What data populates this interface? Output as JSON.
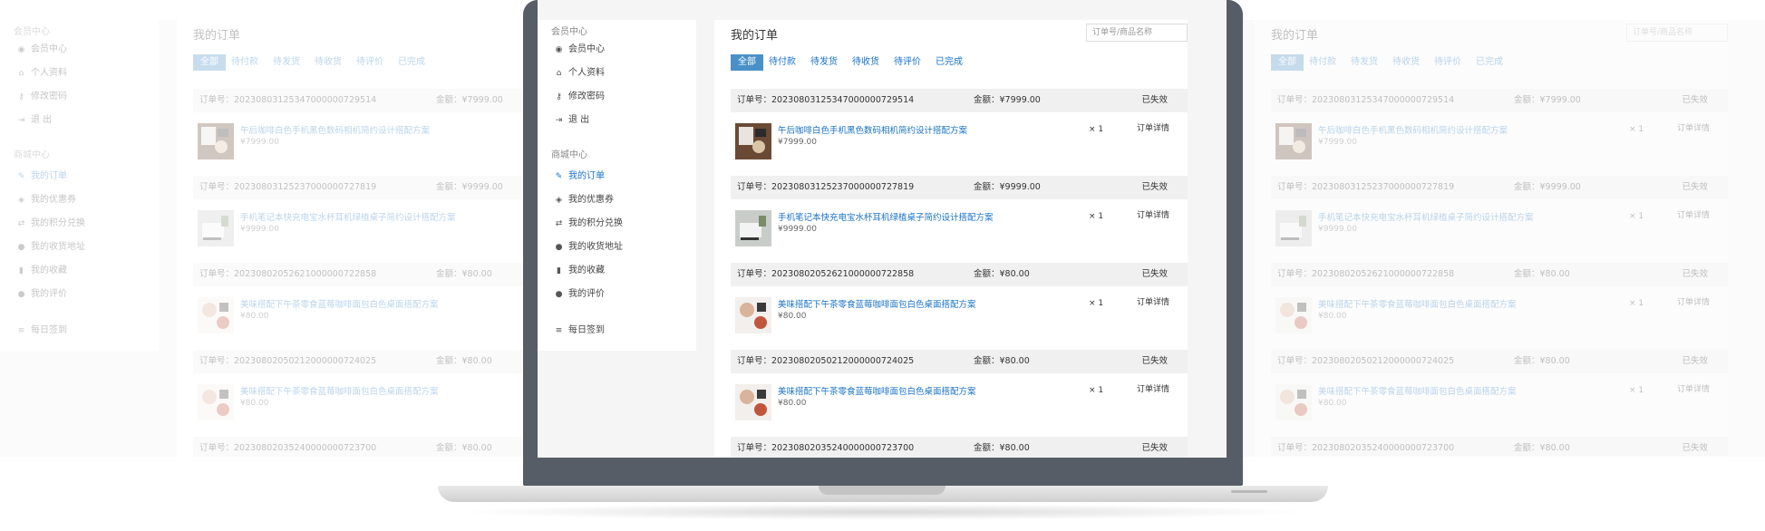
{
  "sidebar": {
    "member_title": "会员中心",
    "member_items": [
      {
        "label": "会员中心",
        "icon": "user-icon"
      },
      {
        "label": "个人资料",
        "icon": "lock-icon"
      },
      {
        "label": "修改密码",
        "icon": "key-icon"
      },
      {
        "label": "退 出",
        "icon": "logout-icon"
      }
    ],
    "mall_title": "商城中心",
    "mall_items": [
      {
        "label": "我的订单",
        "icon": "pencil-icon",
        "active": true
      },
      {
        "label": "我的优惠券",
        "icon": "tag-icon"
      },
      {
        "label": "我的积分兑换",
        "icon": "exchange-icon"
      },
      {
        "label": "我的收货地址",
        "icon": "map-pin-icon"
      },
      {
        "label": "我的收藏",
        "icon": "bookmark-icon"
      },
      {
        "label": "我的评价",
        "icon": "comment-icon"
      }
    ],
    "checkin_label": "每日签到"
  },
  "main": {
    "title": "我的订单",
    "search_placeholder": "订单号/商品名称",
    "tabs": [
      "全部",
      "待付款",
      "待发货",
      "待收货",
      "待评价",
      "已完成"
    ],
    "active_tab": 0
  },
  "labels": {
    "order_no_prefix": "订单号：",
    "amount_prefix": "金额：",
    "detail": "订单详情"
  },
  "orders": [
    {
      "no": "20230803125347000000729514",
      "amount": "¥7999.00",
      "status": "已失效",
      "product": "午后咖啡白色手机黑色数码相机简约设计搭配方案",
      "price": "¥7999.00",
      "qty": "× 1"
    },
    {
      "no": "20230803125237000000727819",
      "amount": "¥9999.00",
      "status": "已失效",
      "product": "手机笔记本快充电宝水杯耳机绿植桌子简约设计搭配方案",
      "price": "¥9999.00",
      "qty": "× 1"
    },
    {
      "no": "20230802052621000000722858",
      "amount": "¥80.00",
      "status": "已失效",
      "product": "美味搭配下午茶零食蓝莓咖啡面包白色桌面搭配方案",
      "price": "¥80.00",
      "qty": "× 1"
    },
    {
      "no": "20230802050212000000724025",
      "amount": "¥80.00",
      "status": "已失效",
      "product": "美味搭配下午茶零食蓝莓咖啡面包白色桌面搭配方案",
      "price": "¥80.00",
      "qty": "× 1"
    },
    {
      "no": "20230802035240000000723700",
      "amount": "¥80.00",
      "status": "已失效",
      "product": "",
      "price": "",
      "qty": ""
    }
  ],
  "colors": {
    "accent": "#1a73c8",
    "tab_active": "#4a90c8",
    "bezel": "#565d66"
  }
}
